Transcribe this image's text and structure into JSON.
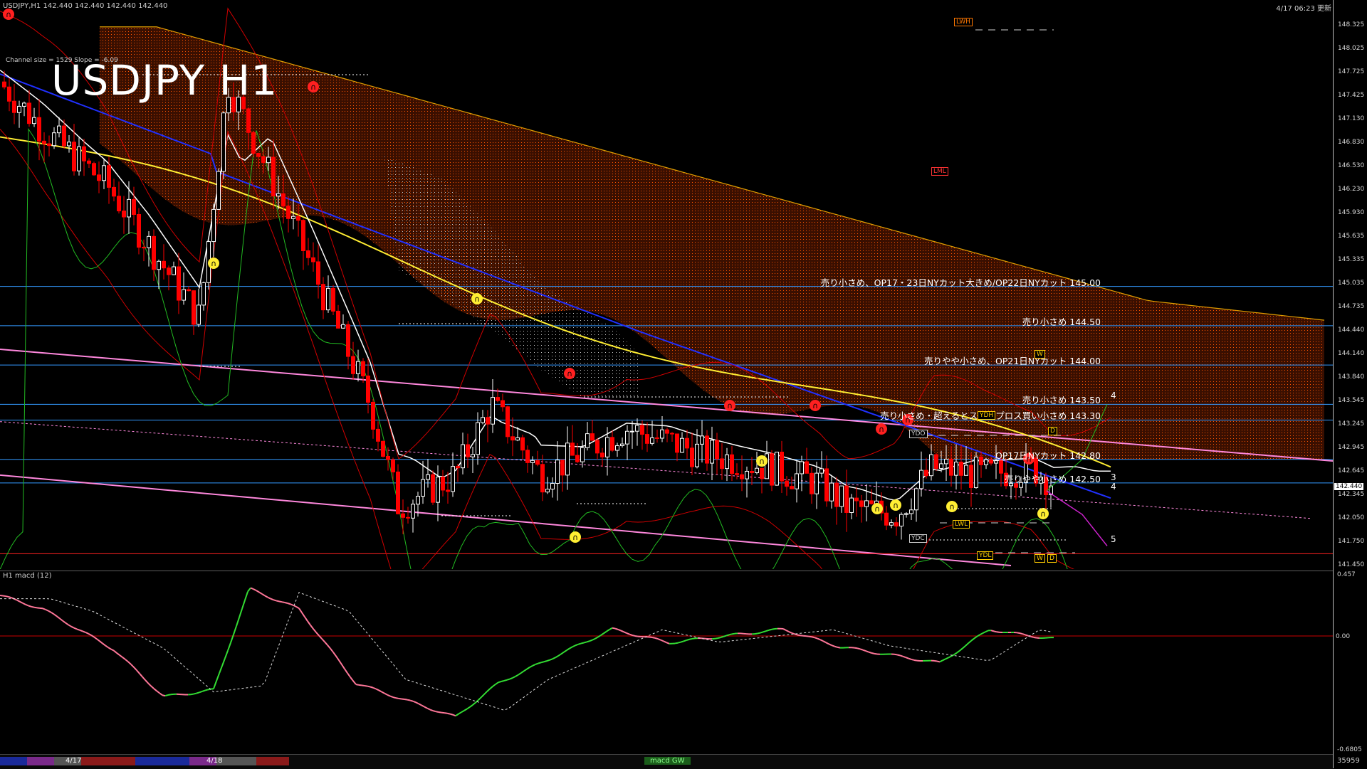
{
  "header": {
    "info": "USDJPY,H1  142.440 142.440 142.440 142.440",
    "timestamp": "4/17 06:23 更新",
    "symbol": "USDJPY  H1",
    "channel": "Channel size = 1529 Slope = -6.09"
  },
  "axis": {
    "ticks": [
      "148.325",
      "148.025",
      "147.725",
      "147.425",
      "147.130",
      "146.830",
      "146.530",
      "146.230",
      "145.930",
      "145.635",
      "145.335",
      "145.035",
      "144.735",
      "144.440",
      "144.140",
      "143.840",
      "143.545",
      "143.245",
      "142.945",
      "142.645",
      "142.345",
      "142.050",
      "141.750",
      "141.450"
    ],
    "current_price": "142.440",
    "sub_ticks": [
      "0.457",
      "0.00",
      "-0.6805"
    ]
  },
  "levels": [
    {
      "label": "売り小さめ、OP17・23日NYカット大きめ/OP22日NYカット 145.00",
      "price": 145.0
    },
    {
      "label": "売り小さめ 144.50",
      "price": 144.5
    },
    {
      "label": "売りやや小さめ、OP21日NYカット 144.00",
      "price": 144.0
    },
    {
      "label": "売り小さめ 143.50",
      "price": 143.5
    },
    {
      "label": "売り小さめ・超えるとストップロス買い小さめ 143.30",
      "price": 143.3
    },
    {
      "label": "OP17日NYカット 142.80",
      "price": 142.8
    },
    {
      "label": "売りやや小さめ 142.50",
      "price": 142.5
    }
  ],
  "tags": {
    "lwh": "LWH",
    "lwl": "LWL",
    "ydh": "YDH",
    "ydl": "YDL",
    "ydo": "YDO",
    "ydc": "YDC",
    "lml": "LML",
    "w": "W",
    "d": "D"
  },
  "wave_numbers": [
    "4",
    "3",
    "4",
    "5"
  ],
  "subwindow": {
    "label": "H1  macd (12)"
  },
  "bottom": {
    "dates": [
      "4/17",
      "4/18"
    ],
    "badge": "macd GW",
    "right": "35959"
  },
  "colors": {
    "background": "#000000",
    "bull": "#ffffff",
    "bear": "#ff0000",
    "cloud": "#ff6600",
    "ma_yellow": "#ffee33",
    "ma_blue": "#2030ff",
    "ma_white": "#ffffff",
    "channel": "#ff88dd",
    "level": "#3399ff",
    "macd_pos": "#33dd33",
    "macd_neg": "#ff7799"
  }
}
